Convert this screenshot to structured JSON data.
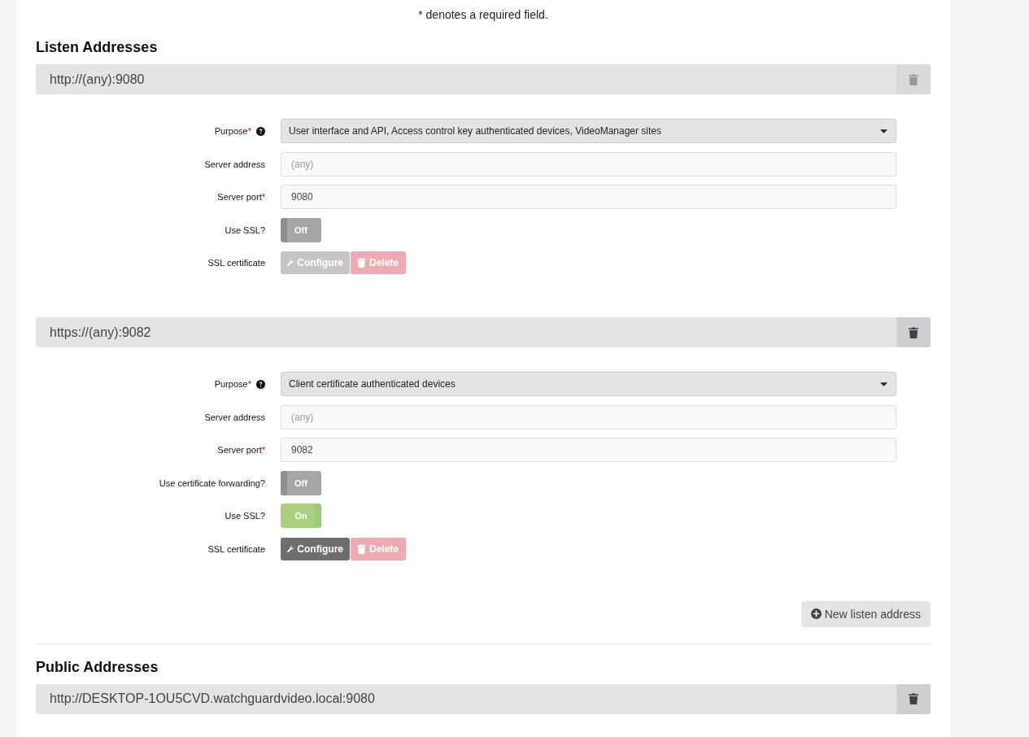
{
  "note": "* denotes a required field.",
  "listen_section": {
    "title": "Listen Addresses",
    "addresses": [
      {
        "url": "http://(any):9080",
        "delete_disabled": true,
        "fields": [
          {
            "kind": "select",
            "label": "Purpose",
            "required_mark": "*",
            "help": true,
            "value": "User interface and API, Access control key authenticated devices, VideoManager sites"
          },
          {
            "kind": "text",
            "label": "Server address",
            "placeholder": "(any)"
          },
          {
            "kind": "text",
            "label": "Server port",
            "required_mark": "*",
            "value": "9080"
          },
          {
            "kind": "toggle",
            "label": "Use SSL?",
            "on": false,
            "text": "Off"
          },
          {
            "kind": "cert",
            "label": "SSL certificate",
            "configure": {
              "label": "Configure",
              "disabled": true
            },
            "delete": {
              "label": "Delete",
              "disabled": true
            }
          }
        ]
      },
      {
        "url": "https://(any):9082",
        "delete_disabled": false,
        "fields": [
          {
            "kind": "select",
            "label": "Purpose",
            "required_mark": "*",
            "help": true,
            "value": "Client certificate authenticated devices"
          },
          {
            "kind": "text",
            "label": "Server address",
            "placeholder": "(any)"
          },
          {
            "kind": "text",
            "label": "Server port",
            "required_mark": "*",
            "value": "9082"
          },
          {
            "kind": "toggle",
            "label": "Use certificate forwarding?",
            "on": false,
            "text": "Off"
          },
          {
            "kind": "toggle",
            "label": "Use SSL?",
            "on": true,
            "text": "On"
          },
          {
            "kind": "cert",
            "label": "SSL certificate",
            "configure": {
              "label": "Configure",
              "disabled": false
            },
            "delete": {
              "label": "Delete",
              "disabled": true
            }
          }
        ]
      }
    ],
    "new_button": "New listen address"
  },
  "public_section": {
    "title": "Public Addresses",
    "addresses": [
      {
        "url": "http://DESKTOP-1OU5CVD.watchguardvideo.local:9080",
        "delete_disabled": false
      }
    ]
  }
}
